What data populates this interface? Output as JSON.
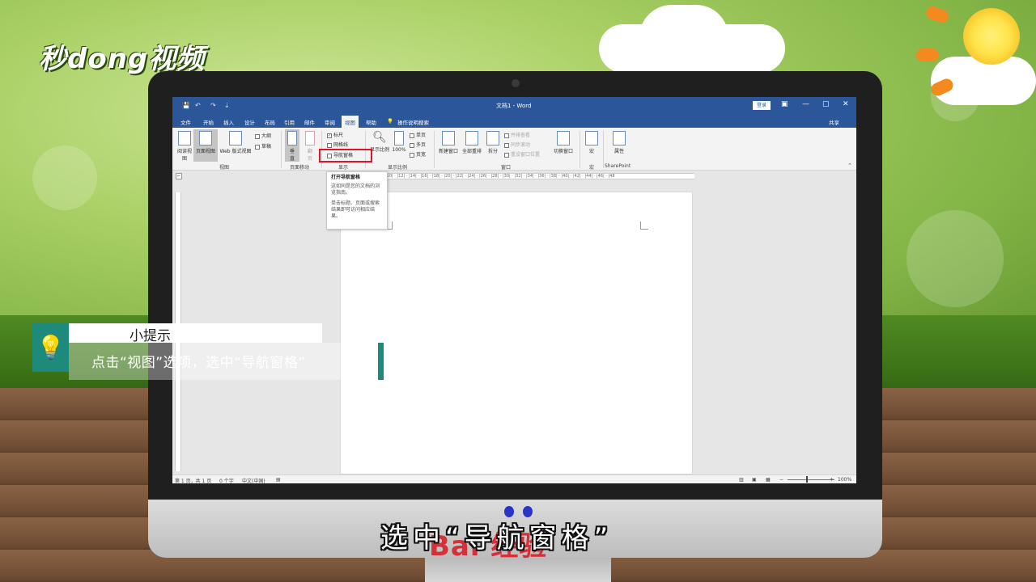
{
  "brand": {
    "logo_text": "秒dong视频"
  },
  "titlebar": {
    "doc_title": "文档1 - Word",
    "login_label": "登录",
    "quick_access": [
      "💾",
      "↶",
      "↷",
      "⇣"
    ]
  },
  "tabs": [
    {
      "label": "文件"
    },
    {
      "label": "开始"
    },
    {
      "label": "插入"
    },
    {
      "label": "设计"
    },
    {
      "label": "布局"
    },
    {
      "label": "引用"
    },
    {
      "label": "邮件"
    },
    {
      "label": "审阅"
    },
    {
      "label": "视图"
    },
    {
      "label": "帮助"
    }
  ],
  "tell_me": "操作说明搜索",
  "share_label": "共享",
  "ribbon": {
    "views": {
      "read_mode": "阅读视图",
      "print_layout": "页面视图",
      "web_layout": "Web 版式视图",
      "outline": "大纲",
      "draft": "草稿",
      "group": "视图"
    },
    "page_move": {
      "vertical": "垂直",
      "side": "翻页",
      "group": "页面移动"
    },
    "show": {
      "ruler": "标尺",
      "gridlines": "网格线",
      "nav_pane": "导航窗格",
      "group": "显示"
    },
    "zoom": {
      "zoom": "显示比例",
      "hundred": "100%",
      "one_page": "单页",
      "multi_page": "多页",
      "page_width": "页宽",
      "group": "显示比例"
    },
    "window": {
      "new_window": "新建窗口",
      "arrange_all": "全部重排",
      "split": "拆分",
      "side_by_side": "并排查看",
      "sync_scroll": "同步滚动",
      "reset_pos": "重设窗口位置",
      "switch": "切换窗口",
      "group": "窗口"
    },
    "macros": {
      "label": "宏",
      "group": "宏"
    },
    "sharepoint": {
      "label": "属性",
      "group": "SharePoint"
    }
  },
  "tooltip": {
    "title": "打开导航窗格",
    "line1": "这如同是您的文档的浏览指南。",
    "line2": "单击标题、页面或搜索结果即可访问相应结果。"
  },
  "ruler_text": "| 2 | · | 4 | · | 6 | · | 8 | · |10| · |12| · |14| · |16| · |18| · |20| · |22| · |24| · |26| · |28| · |30| · |32| · |34| · |36| · |38| · |40| · |42| · |44| · |46| · |48",
  "status": {
    "page": "第 1 页，共 1 页",
    "words": "0 个字",
    "lang": "中文(中国)",
    "zoom": "100%"
  },
  "tip": {
    "heading": "小提示",
    "body": "点击“视图”选项，选中“导航窗格”"
  },
  "subtitle": "选中“导航窗格”",
  "watermark": "Bai 经验",
  "colors": {
    "word_blue": "#2b579a",
    "tip_teal": "#1d8a7c",
    "highlight_red": "#e3112a"
  }
}
